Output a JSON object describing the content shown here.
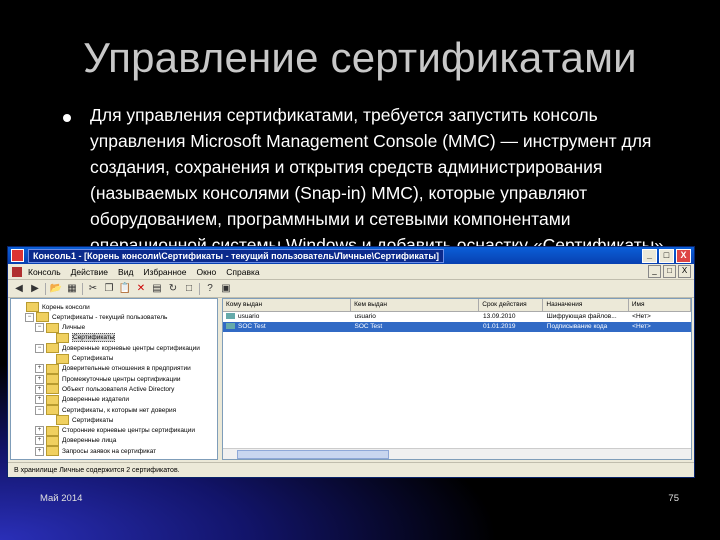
{
  "slide": {
    "title": "Управление сертификатами",
    "bullet": "Для управления сертификатами, требуется запустить консоль управления Microsoft Management Console (MMC) — инструмент для создания, сохранения и открытия средств администрирования (называемых консолями (Snap-in) MMC), которые управляют оборудованием, программными и сетевыми компонентами операционной системы Windows и добавить оснастку «Сертификаты».",
    "footer_date": "Май 2014",
    "page_number": "75"
  },
  "mmc": {
    "title": "Консоль1 - [Корень консоли\\Сертификаты - текущий пользователь\\Личные\\Сертификаты]",
    "window_buttons": [
      "_",
      "□",
      "X"
    ],
    "menu": [
      "Консоль",
      "Действие",
      "Вид",
      "Избранное",
      "Окно",
      "Справка"
    ],
    "tree": [
      {
        "label": "Корень консоли",
        "expander": "",
        "indent": 0
      },
      {
        "label": "Сертификаты - текущий пользователь",
        "expander": "−",
        "indent": 1
      },
      {
        "label": "Личные",
        "expander": "−",
        "indent": 2
      },
      {
        "label": "Сертификаты",
        "expander": "",
        "indent": 3,
        "selected": true
      },
      {
        "label": "Доверенные корневые центры сертификации",
        "expander": "−",
        "indent": 2
      },
      {
        "label": "Сертификаты",
        "expander": "",
        "indent": 3
      },
      {
        "label": "Доверительные отношения в предприятии",
        "expander": "+",
        "indent": 2
      },
      {
        "label": "Промежуточные центры сертификации",
        "expander": "+",
        "indent": 2
      },
      {
        "label": "Объект пользователя Active Directory",
        "expander": "+",
        "indent": 2
      },
      {
        "label": "Доверенные издатели",
        "expander": "+",
        "indent": 2
      },
      {
        "label": "Сертификаты, к которым нет доверия",
        "expander": "−",
        "indent": 2
      },
      {
        "label": "Сертификаты",
        "expander": "",
        "indent": 3
      },
      {
        "label": "Сторонние корневые центры сертификации",
        "expander": "+",
        "indent": 2
      },
      {
        "label": "Доверенные лица",
        "expander": "+",
        "indent": 2
      },
      {
        "label": "Запросы заявок на сертификат",
        "expander": "+",
        "indent": 2
      }
    ],
    "columns": [
      "Кому выдан",
      "Кем выдан",
      "Срок действия",
      "Назначения",
      "Имя"
    ],
    "rows": [
      {
        "to": "usuario",
        "by": "usuario",
        "expires": "13.09.2010",
        "purposes": "Шифрующая файлов...",
        "name": "<Нет>"
      },
      {
        "to": "SOC Test",
        "by": "SOC Test",
        "expires": "01.01.2019",
        "purposes": "Подписывание кода",
        "name": "<Нет>",
        "selected": true
      }
    ],
    "status": "В хранилище Личные содержится 2 сертификатов."
  }
}
